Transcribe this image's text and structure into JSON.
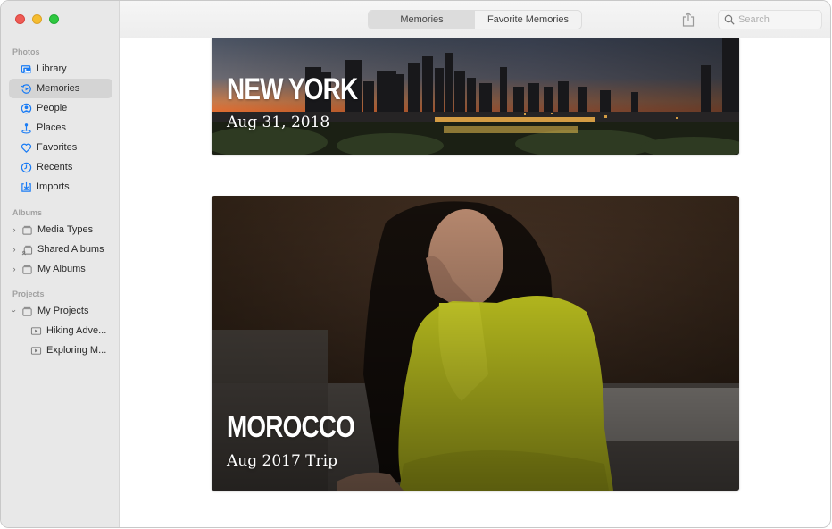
{
  "window": {
    "controls": [
      "close",
      "minimize",
      "zoom"
    ]
  },
  "sidebar": {
    "sections": [
      {
        "label": "Photos",
        "items": [
          {
            "label": "Library",
            "icon": "library-icon",
            "selected": false
          },
          {
            "label": "Memories",
            "icon": "memories-icon",
            "selected": true
          },
          {
            "label": "People",
            "icon": "people-icon",
            "selected": false
          },
          {
            "label": "Places",
            "icon": "places-icon",
            "selected": false
          },
          {
            "label": "Favorites",
            "icon": "heart-icon",
            "selected": false
          },
          {
            "label": "Recents",
            "icon": "clock-icon",
            "selected": false
          },
          {
            "label": "Imports",
            "icon": "import-icon",
            "selected": false
          }
        ]
      },
      {
        "label": "Albums",
        "items": [
          {
            "label": "Media Types",
            "icon": "album-stack-icon",
            "expanded": false
          },
          {
            "label": "Shared Albums",
            "icon": "shared-album-icon",
            "expanded": false
          },
          {
            "label": "My Albums",
            "icon": "album-stack-icon",
            "expanded": false
          }
        ]
      },
      {
        "label": "Projects",
        "items": [
          {
            "label": "My Projects",
            "icon": "album-stack-icon",
            "expanded": true
          },
          {
            "label": "Hiking Adve...",
            "icon": "slideshow-icon"
          },
          {
            "label": "Exploring M...",
            "icon": "slideshow-icon"
          }
        ]
      }
    ]
  },
  "toolbar": {
    "tabs": [
      {
        "label": "Memories",
        "active": true
      },
      {
        "label": "Favorite Memories",
        "active": false
      }
    ],
    "share_icon": "share-icon",
    "search": {
      "placeholder": "Search",
      "value": ""
    }
  },
  "memories": [
    {
      "title": "NEW YORK",
      "subtitle": "Aug 31, 2018"
    },
    {
      "title": "MOROCCO",
      "subtitle": "Aug 2017 Trip"
    }
  ],
  "colors": {
    "accent": "#1a7cf5",
    "sidebar_bg": "#e8e8e8",
    "selected_bg": "#d4d4d4"
  }
}
